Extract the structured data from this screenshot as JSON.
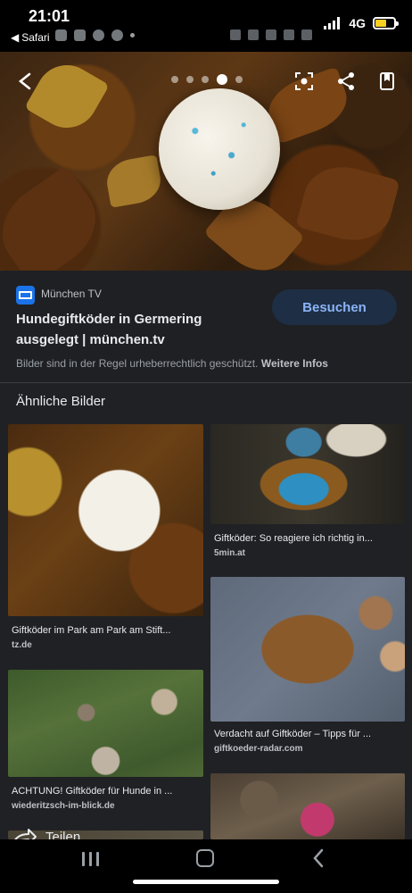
{
  "status_bar": {
    "time": "21:01",
    "back_label": "Safari",
    "network": "4G",
    "battery_level": 0.6,
    "battery_color": "#f5d020"
  },
  "hero": {
    "active_index": 3,
    "dot_count": 5,
    "icons": [
      "close-icon",
      "lens-icon",
      "share-icon",
      "bookmark-icon"
    ]
  },
  "source": {
    "name": "München TV",
    "title": "Hundegiftköder in Germering ausgelegt | münchen.tv",
    "visit_label": "Besuchen",
    "copyright_text": "Bilder sind in der Regel urheberrechtlich geschützt.",
    "more_info_label": "Weitere Infos"
  },
  "related": {
    "heading": "Ähnliche Bilder",
    "items": [
      {
        "title": "Giftköder im Park am Park am Stift...",
        "domain": "tz.de"
      },
      {
        "title": "Giftköder: So reagiere ich richtig in...",
        "domain": "5min.at"
      },
      {
        "title": "ACHTUNG! Giftköder für Hunde in ...",
        "domain": "wiederitzsch-im-blick.de"
      },
      {
        "title": "Verdacht auf Giftköder – Tipps für ...",
        "domain": "giftkoeder-radar.com"
      }
    ]
  },
  "bottom": {
    "share_label": "Teilen"
  },
  "colors": {
    "accent": "#8ab4f8",
    "visit_bg": "#1e2e44",
    "background": "#202124"
  }
}
